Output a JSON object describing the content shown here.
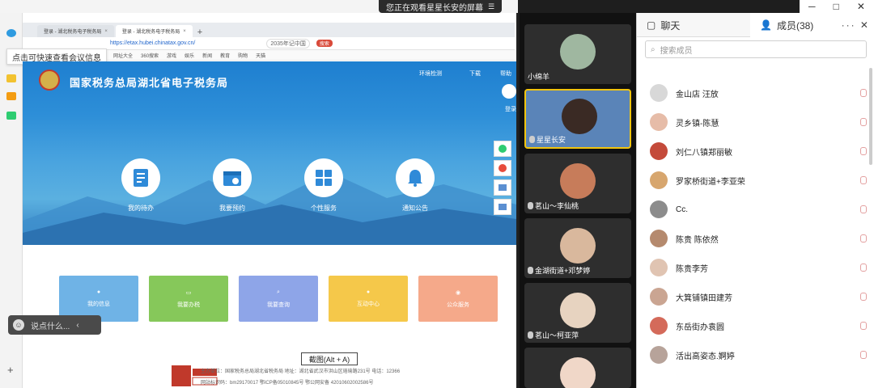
{
  "banner": {
    "text": "您正在观看星星长安的屏幕",
    "menu": "☰"
  },
  "window_controls": [
    "─",
    "□",
    "✕"
  ],
  "browser": {
    "tabs": [
      {
        "label": "登录 - 湖北税务电子税务局"
      },
      {
        "label": "登录 - 湖北税务电子税务局"
      }
    ],
    "url": "https://etax.hubei.chinatax.gov.cn/",
    "search_text": "2035年记中国",
    "search_button": "搜索",
    "bookmarks": [
      "网址大全",
      "360搜索",
      "游戏",
      "娱乐",
      "新闻",
      "教育",
      "购物",
      "天猫"
    ]
  },
  "tooltip_quick": "点击可快速查看会议信息",
  "site": {
    "title": "国家税务总局湖北省电子税务局",
    "links": [
      "环境检测",
      "下载",
      "帮助"
    ],
    "login": "登录",
    "services": [
      {
        "label": "我的待办",
        "icon": "todo-icon"
      },
      {
        "label": "我要预约",
        "icon": "calendar-icon"
      },
      {
        "label": "个性服务",
        "icon": "grid-icon"
      },
      {
        "label": "通知公告",
        "icon": "bell-icon"
      }
    ],
    "tiles": [
      {
        "label": "我的信息",
        "color": "#6fb3e6"
      },
      {
        "label": "我要办税",
        "color": "#86c85a"
      },
      {
        "label": "我要查询",
        "color": "#8ea5e8"
      },
      {
        "label": "互动中心",
        "color": "#f5c84a"
      },
      {
        "label": "公众服务",
        "color": "#f5a98a"
      }
    ],
    "footer": [
      "主办单位：国家税务总局湖北省税务局  地址：湖北省武汉市洪山区珞瑜路231号  电话：12366",
      "网站标识码：bm29170017  鄂ICP备05010845号  鄂公网安备 42010602002586号"
    ],
    "footer_badge": "政府网站找错"
  },
  "chat_input": {
    "placeholder": "说点什么...",
    "collapse": "‹"
  },
  "screenshot_tip": "截图(Alt + A)",
  "videos": [
    {
      "name": "小绵羊",
      "mic": false
    },
    {
      "name": "星星长安",
      "mic": true,
      "active": true
    },
    {
      "name": "茗山～李仙桃",
      "mic": true
    },
    {
      "name": "金湖街道+邓梦婷",
      "mic": true
    },
    {
      "name": "茗山～柯亚萍",
      "mic": true
    },
    {
      "name": "",
      "mic": false
    }
  ],
  "panel": {
    "chat_tab": "聊天",
    "members_tab": "成员(38)",
    "members_ctrls": "··· ✕",
    "search_placeholder": "搜索成员",
    "members": [
      "金山店 汪放",
      "灵乡镇-陈慧",
      "刘仁八镇郑丽敏",
      "罗家桥街道+李亚荣",
      "Cc.",
      "陈贵  陈依然",
      "陈贵李芳",
      "大箕铺镇田建芳",
      "东岳街办袁圆",
      "活出高姿态.婀婷"
    ]
  }
}
